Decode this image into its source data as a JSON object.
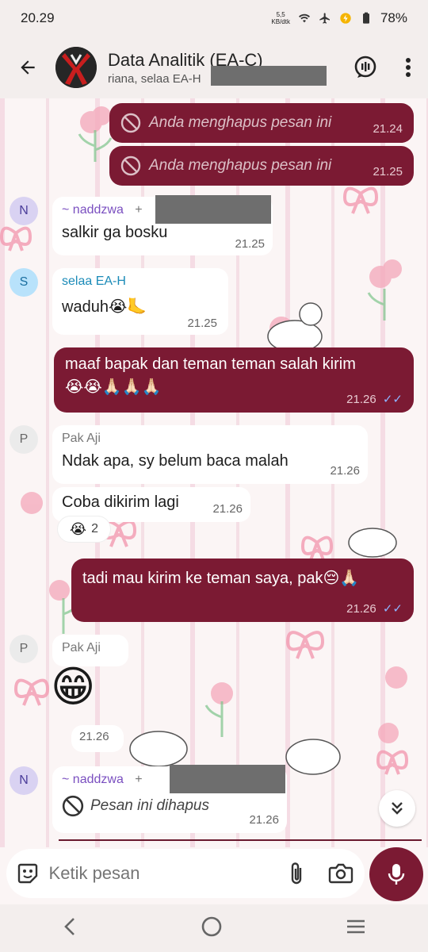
{
  "status": {
    "time": "20.29",
    "speed_value": "5,5",
    "speed_unit": "KB/dtk",
    "battery": "78%"
  },
  "header": {
    "title": "Data Analitik (EA-C)",
    "subtitle": "riana, selaa EA-H"
  },
  "messages": {
    "m1": {
      "text": "Anda menghapus pesan ini",
      "time": "21.24"
    },
    "m2": {
      "text": "Anda menghapus pesan ini",
      "time": "21.25"
    },
    "m3": {
      "initial": "N",
      "sender": "~ naddzwa",
      "sender_suffix": "+",
      "text": "salkir ga bosku",
      "time": "21.25"
    },
    "m4": {
      "initial": "S",
      "sender": "selaa EA-H",
      "text": "waduh",
      "time": "21.25"
    },
    "m5": {
      "text": "maaf bapak dan teman teman salah kirim",
      "time": "21.26"
    },
    "m6": {
      "initial": "P",
      "sender": "Pak Aji",
      "text": "Ndak apa, sy belum baca malah",
      "time": "21.26"
    },
    "m7": {
      "text": "Coba dikirim lagi",
      "time": "21.26",
      "reaction_count": "2"
    },
    "m8": {
      "text": "tadi mau kirim ke teman saya, pak",
      "time": "21.26"
    },
    "m9": {
      "initial": "P",
      "sender": "Pak Aji",
      "emoji": "😁",
      "time": "21.26"
    },
    "m10": {
      "initial": "N",
      "sender": "~ naddzwa",
      "sender_suffix": "+",
      "text": "Pesan ini dihapus",
      "time": "21.26"
    }
  },
  "input": {
    "placeholder": "Ketik pesan"
  },
  "colors": {
    "outgoing_bubble": "#7b1a33",
    "accent": "#7b1a33",
    "read_ticks": "#8fb4ff"
  }
}
